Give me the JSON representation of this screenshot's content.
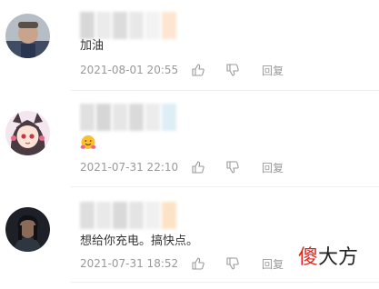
{
  "comments": [
    {
      "text": "加油",
      "time": "2021-08-01 20:55",
      "reply_label": "回复",
      "avatar_icon": "man-avatar-icon"
    },
    {
      "text": "",
      "emoji_icon": "hugging-face-emoji-icon",
      "time": "2021-07-31 22:10",
      "reply_label": "回复",
      "avatar_icon": "anime-girl-avatar-icon"
    },
    {
      "text": "想给你充电。搞快点。",
      "time": "2021-07-31 18:52",
      "reply_label": "回复",
      "avatar_icon": "dark-portrait-avatar-icon"
    }
  ],
  "watermark": {
    "first": "傻",
    "rest": "大方"
  },
  "colors": {
    "meta_text": "#999999",
    "body_text": "#333333",
    "watermark_red": "#e0251b"
  }
}
